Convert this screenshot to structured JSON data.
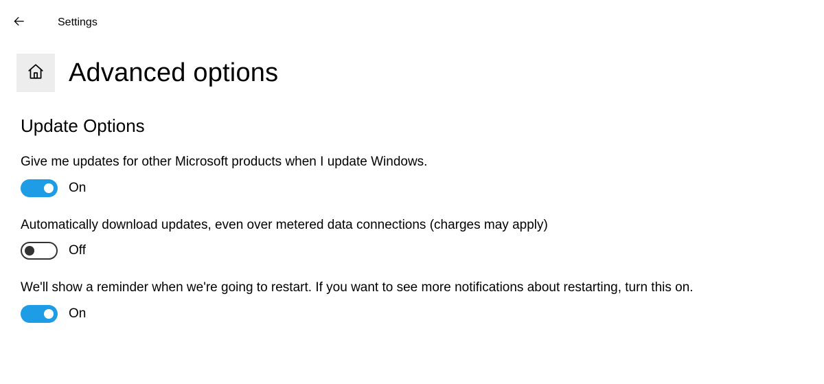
{
  "app_title": "Settings",
  "page_title": "Advanced options",
  "section_heading": "Update Options",
  "settings": [
    {
      "label": "Give me updates for other Microsoft products when I update Windows.",
      "state": "On",
      "on": true
    },
    {
      "label": "Automatically download updates, even over metered data connections (charges may apply)",
      "state": "Off",
      "on": false
    },
    {
      "label": "We'll show a reminder when we're going to restart. If you want to see more notifications about restarting, turn this on.",
      "state": "On",
      "on": true
    }
  ]
}
